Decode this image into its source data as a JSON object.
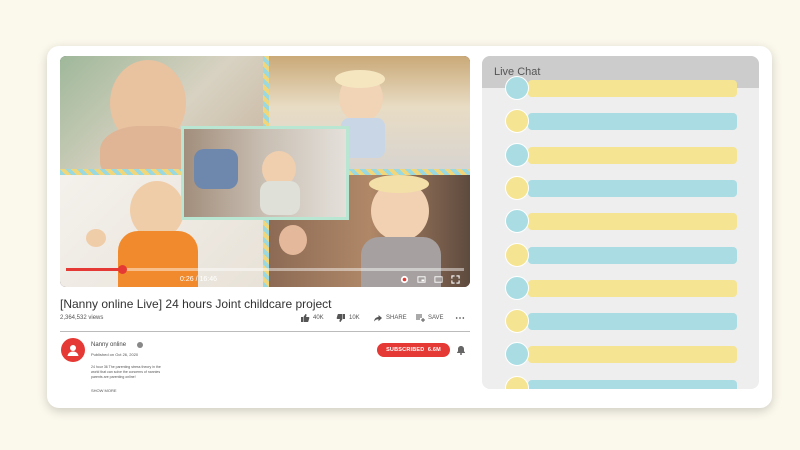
{
  "video": {
    "current_time": "0:26",
    "duration": "16:46",
    "time_separator": " / ",
    "progress": 0.14
  },
  "info": {
    "title": "[Nanny online Live] 24 hours Joint childcare project",
    "views": "2,364,532 views",
    "actions": [
      {
        "icon": "thumbs-up-icon",
        "label": "40K"
      },
      {
        "icon": "thumbs-down-icon",
        "label": "10K"
      },
      {
        "icon": "share-icon",
        "label": "SHARE"
      },
      {
        "icon": "save-icon",
        "label": "SAVE"
      }
    ]
  },
  "channel": {
    "name": "Nanny online",
    "published": "Published on Oct 26, 2020",
    "description": "24 hour 36 The parenting stress theory in the world that can solve the concerns of nannies parents are parenting online!",
    "show_more": "SHOW MORE",
    "subscribe_label": "SUBSCRIBED",
    "subscriber_count": "6.6M"
  },
  "chat": {
    "title": "Live Chat",
    "rows": [
      {
        "circle": "#a9dde3",
        "bar": "#f5e491"
      },
      {
        "circle": "#f5e491",
        "bar": "#a9dde3"
      },
      {
        "circle": "#a9dde3",
        "bar": "#f5e491"
      },
      {
        "circle": "#f5e491",
        "bar": "#a9dde3"
      },
      {
        "circle": "#a9dde3",
        "bar": "#f5e491"
      },
      {
        "circle": "#f5e491",
        "bar": "#a9dde3"
      },
      {
        "circle": "#a9dde3",
        "bar": "#f5e491"
      },
      {
        "circle": "#f5e491",
        "bar": "#a9dde3"
      },
      {
        "circle": "#a9dde3",
        "bar": "#f5e491"
      },
      {
        "circle": "#f5e491",
        "bar": "#a9dde3"
      }
    ]
  },
  "colors": {
    "accent": "#e53935",
    "chat_blue": "#a9dde3",
    "chat_yellow": "#f5e491"
  }
}
